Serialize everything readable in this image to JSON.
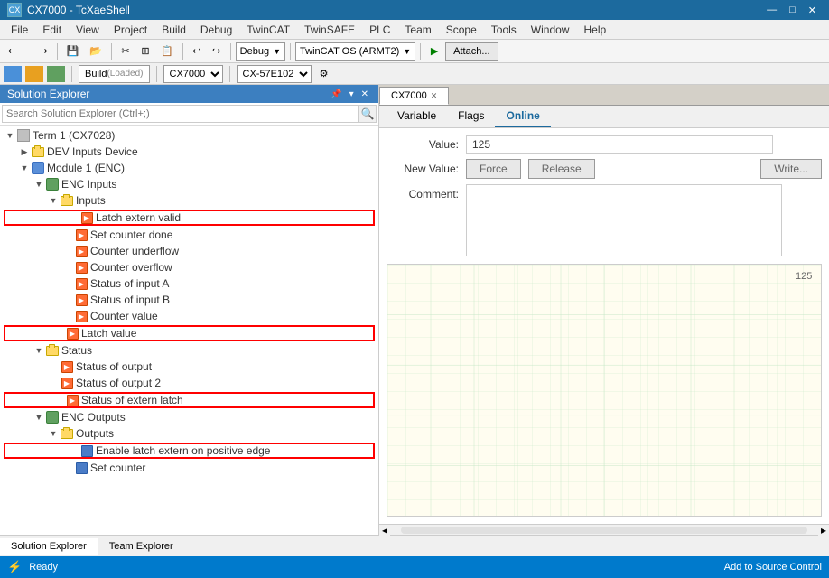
{
  "titleBar": {
    "title": "CX7000 - TcXaeShell",
    "icon": "CX",
    "btns": [
      "—",
      "□",
      "✕"
    ]
  },
  "menuBar": {
    "items": [
      "File",
      "Edit",
      "View",
      "Project",
      "Build",
      "Debug",
      "TwinCAT",
      "TwinSAFE",
      "PLC",
      "Team",
      "Scope",
      "Tools",
      "Window",
      "Help"
    ]
  },
  "toolbar": {
    "mode_dropdown": "Debug",
    "target_dropdown": "TwinCAT OS (ARMT2)",
    "attach_btn": "Attach..."
  },
  "buildBar": {
    "build_label": "Build",
    "loaded_label": "(Loaded)",
    "cx_select": "CX7000",
    "target_select": "CX-57E102"
  },
  "solutionExplorer": {
    "title": "Solution Explorer",
    "search_placeholder": "Search Solution Explorer (Ctrl+;)",
    "tree": [
      {
        "id": "term1",
        "label": "Term 1 (CX7028)",
        "level": 0,
        "expanded": true,
        "type": "term"
      },
      {
        "id": "dev_inputs",
        "label": "DEV Inputs Device",
        "level": 1,
        "expanded": false,
        "type": "folder"
      },
      {
        "id": "module1",
        "label": "Module 1 (ENC)",
        "level": 1,
        "expanded": true,
        "type": "module"
      },
      {
        "id": "enc_inputs",
        "label": "ENC Inputs",
        "level": 2,
        "expanded": true,
        "type": "enc"
      },
      {
        "id": "inputs",
        "label": "Inputs",
        "level": 3,
        "expanded": true,
        "type": "folder"
      },
      {
        "id": "latch_extern",
        "label": "Latch extern valid",
        "level": 4,
        "highlighted": true,
        "type": "sig"
      },
      {
        "id": "set_counter",
        "label": "Set counter done",
        "level": 4,
        "type": "sig"
      },
      {
        "id": "counter_under",
        "label": "Counter underflow",
        "level": 4,
        "type": "sig"
      },
      {
        "id": "counter_over",
        "label": "Counter overflow",
        "level": 4,
        "type": "sig"
      },
      {
        "id": "status_a",
        "label": "Status of input A",
        "level": 4,
        "type": "sig"
      },
      {
        "id": "status_b",
        "label": "Status of input B",
        "level": 4,
        "type": "sig"
      },
      {
        "id": "counter_val",
        "label": "Counter value",
        "level": 4,
        "type": "sig"
      },
      {
        "id": "latch_value",
        "label": "Latch value",
        "level": 3,
        "highlighted": true,
        "type": "sig"
      },
      {
        "id": "status",
        "label": "Status",
        "level": 2,
        "expanded": true,
        "type": "folder"
      },
      {
        "id": "status_out",
        "label": "Status of output",
        "level": 3,
        "type": "sig"
      },
      {
        "id": "status_out2",
        "label": "Status of output 2",
        "level": 3,
        "type": "sig"
      },
      {
        "id": "status_extern",
        "label": "Status of extern latch",
        "level": 3,
        "highlighted": true,
        "type": "sig"
      },
      {
        "id": "enc_outputs",
        "label": "ENC Outputs",
        "level": 2,
        "expanded": true,
        "type": "enc"
      },
      {
        "id": "outputs",
        "label": "Outputs",
        "level": 3,
        "expanded": true,
        "type": "folder"
      },
      {
        "id": "enable_latch",
        "label": "Enable latch extern on positive edge",
        "level": 4,
        "highlighted": true,
        "type": "sig_blue"
      },
      {
        "id": "set_counter2",
        "label": "Set counter",
        "level": 4,
        "type": "sig_blue"
      }
    ]
  },
  "rightPanel": {
    "tabs": [
      {
        "label": "CX7000",
        "active": true,
        "pinned": false
      },
      {
        "label": "",
        "active": false,
        "pinned": true
      }
    ],
    "cx_tabs": [
      {
        "label": "Variable",
        "active": false
      },
      {
        "label": "Flags",
        "active": false
      },
      {
        "label": "Online",
        "active": true
      }
    ],
    "online": {
      "value_label": "Value:",
      "value": "125",
      "new_value_label": "New Value:",
      "force_btn": "Force",
      "release_btn": "Release",
      "write_btn": "Write...",
      "comment_label": "Comment:"
    },
    "chart": {
      "value_label": "125"
    }
  },
  "statusBar": {
    "ready": "Ready",
    "source_control": "Add to Source Control"
  }
}
